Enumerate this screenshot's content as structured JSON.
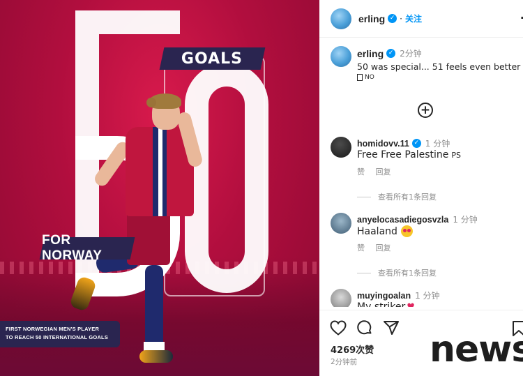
{
  "post_image": {
    "goals_label": "GOALS",
    "norway_label": "FOR NORWAY",
    "caption_line1": "FIRST NORWEGIAN MEN'S PLAYER",
    "caption_line2": "TO REACH 50 INTERNATIONAL GOALS"
  },
  "header": {
    "username": "erling",
    "verified_mark": "✓",
    "separator": "·",
    "follow_label": "关注",
    "more_label": "·"
  },
  "caption": {
    "username": "erling",
    "time": "2分钟",
    "text": "50 was special... 51 feels even better",
    "flag_text": "NO"
  },
  "load_more_label": "+",
  "comments": [
    {
      "username": "homidovv.11",
      "verified": true,
      "time": "1 分钟",
      "text": "Free Free Palestine",
      "suffix": "PS",
      "like_label": "赞",
      "reply_label": "回复",
      "view_replies": "查看所有1条回复"
    },
    {
      "username": "anyelocasadiegosvzla",
      "verified": false,
      "time": "1 分钟",
      "text": "Haaland",
      "like_label": "赞",
      "reply_label": "回复",
      "view_replies": "查看所有1条回复"
    },
    {
      "username": "muyingoalan",
      "verified": false,
      "time": "1 分钟",
      "text": "My striker"
    }
  ],
  "actions": {
    "likes": "4269次赞",
    "posted_ago": "2分钟前"
  },
  "watermark": "news",
  "colors": {
    "accent_blue": "#0095f6",
    "image_red": "#b10e3e",
    "badge_navy": "#2a2550"
  },
  "icons": [
    "heart-icon",
    "comment-icon",
    "share-icon",
    "bookmark-icon",
    "plus-circle-icon",
    "verified-icon"
  ]
}
